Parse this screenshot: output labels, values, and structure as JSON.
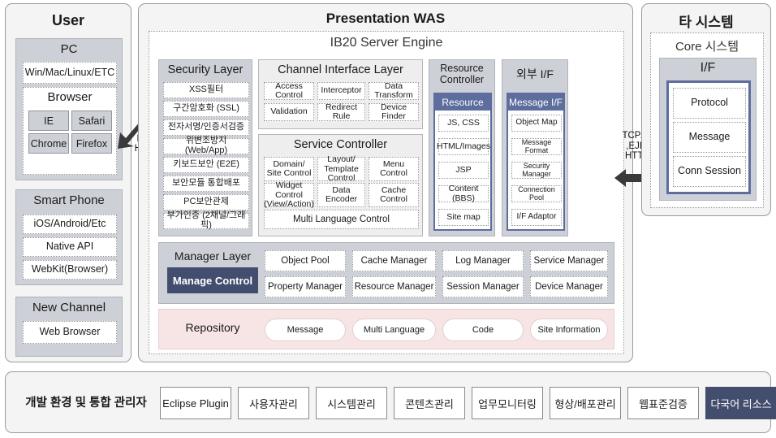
{
  "user": {
    "title": "User",
    "pc": {
      "title": "PC",
      "os": "Win/Mac/Linux/ETC",
      "browser_title": "Browser",
      "browsers": [
        "IE",
        "Safari",
        "Chrome",
        "Firefox"
      ]
    },
    "smartphone": {
      "title": "Smart Phone",
      "items": [
        "iOS/Android/Etc",
        "Native API",
        "WebKit(Browser)"
      ]
    },
    "new_channel": {
      "title": "New Channel",
      "items": [
        "Web Browser"
      ]
    }
  },
  "connectors": {
    "left": {
      "label": "Http\nHttps",
      "line1": "Http",
      "line2": "Https",
      "icon": "double-arrow-diagonal"
    },
    "right": {
      "line1": "TCP/IP",
      "line2": ",EJB,",
      "line3": "HTTP",
      "icon": "double-arrow-horizontal"
    }
  },
  "was": {
    "title": "Presentation WAS",
    "engine_title": "IB20 Server Engine",
    "security_layer": {
      "title": "Security Layer",
      "items": [
        "XSS필터",
        "구간암호화 (SSL)",
        "전자서명/인증서검증",
        "위변조방지 (Web/App)",
        "키보드보안 (E2E)",
        "보안모듈 통합배포",
        "PC보안관제",
        "부가인증 (2채널/그래픽)"
      ]
    },
    "channel_interface_layer": {
      "title": "Channel Interface Layer",
      "items": [
        "Access Control",
        "Interceptor",
        "Data Transform",
        "Validation",
        "Redirect Rule",
        "Device Finder"
      ]
    },
    "service_controller": {
      "title": "Service Controller",
      "items": [
        "Domain/\nSite Control",
        "Layout/\nTemplate Control",
        "Menu Control",
        "Widget Control\n(View/Action)",
        "Data\nEncoder",
        "Cache\nControl"
      ],
      "full_width_item": "Multi Language Control"
    },
    "resource_controller": {
      "title": "Resource\nController",
      "inner_header": "Resource",
      "items": [
        "JS, CSS",
        "HTML/Images",
        "JSP",
        "Content (BBS)",
        "Site map"
      ]
    },
    "external_if": {
      "title": "외부 I/F",
      "inner_header": "Message I/F",
      "items": [
        "Object Map",
        "Message Format",
        "Security Manager",
        "Connection Pool",
        "I/F Adaptor"
      ]
    },
    "manager_layer": {
      "title": "Manager Layer",
      "control_label": "Manage Control",
      "items": [
        "Object Pool",
        "Cache Manager",
        "Log Manager",
        "Service Manager",
        "Property Manager",
        "Resource Manager",
        "Session Manager",
        "Device Manager"
      ]
    },
    "repository": {
      "title": "Repository",
      "items": [
        "Message",
        "Multi Language",
        "Code",
        "Site Information"
      ]
    }
  },
  "other_system": {
    "title": "타 시스템",
    "core_title": "Core 시스템",
    "if_title": "I/F",
    "items": [
      "Protocol",
      "Message",
      "Conn Session"
    ]
  },
  "bottom_bar": {
    "title": "개발 환경 및 통합 관리자",
    "buttons": [
      "Eclipse Plugin",
      "사용자관리",
      "시스템관리",
      "콘텐츠관리",
      "업무모니터링",
      "형상/배포관리",
      "웹표준검증",
      "다국어 리소스"
    ],
    "active_index": 7
  },
  "colors": {
    "accent_blue": "#5c6d9e",
    "accent_navy": "#434e6e",
    "panel_gray": "#cdd0d6",
    "repository_pink": "#f7e4e4"
  }
}
